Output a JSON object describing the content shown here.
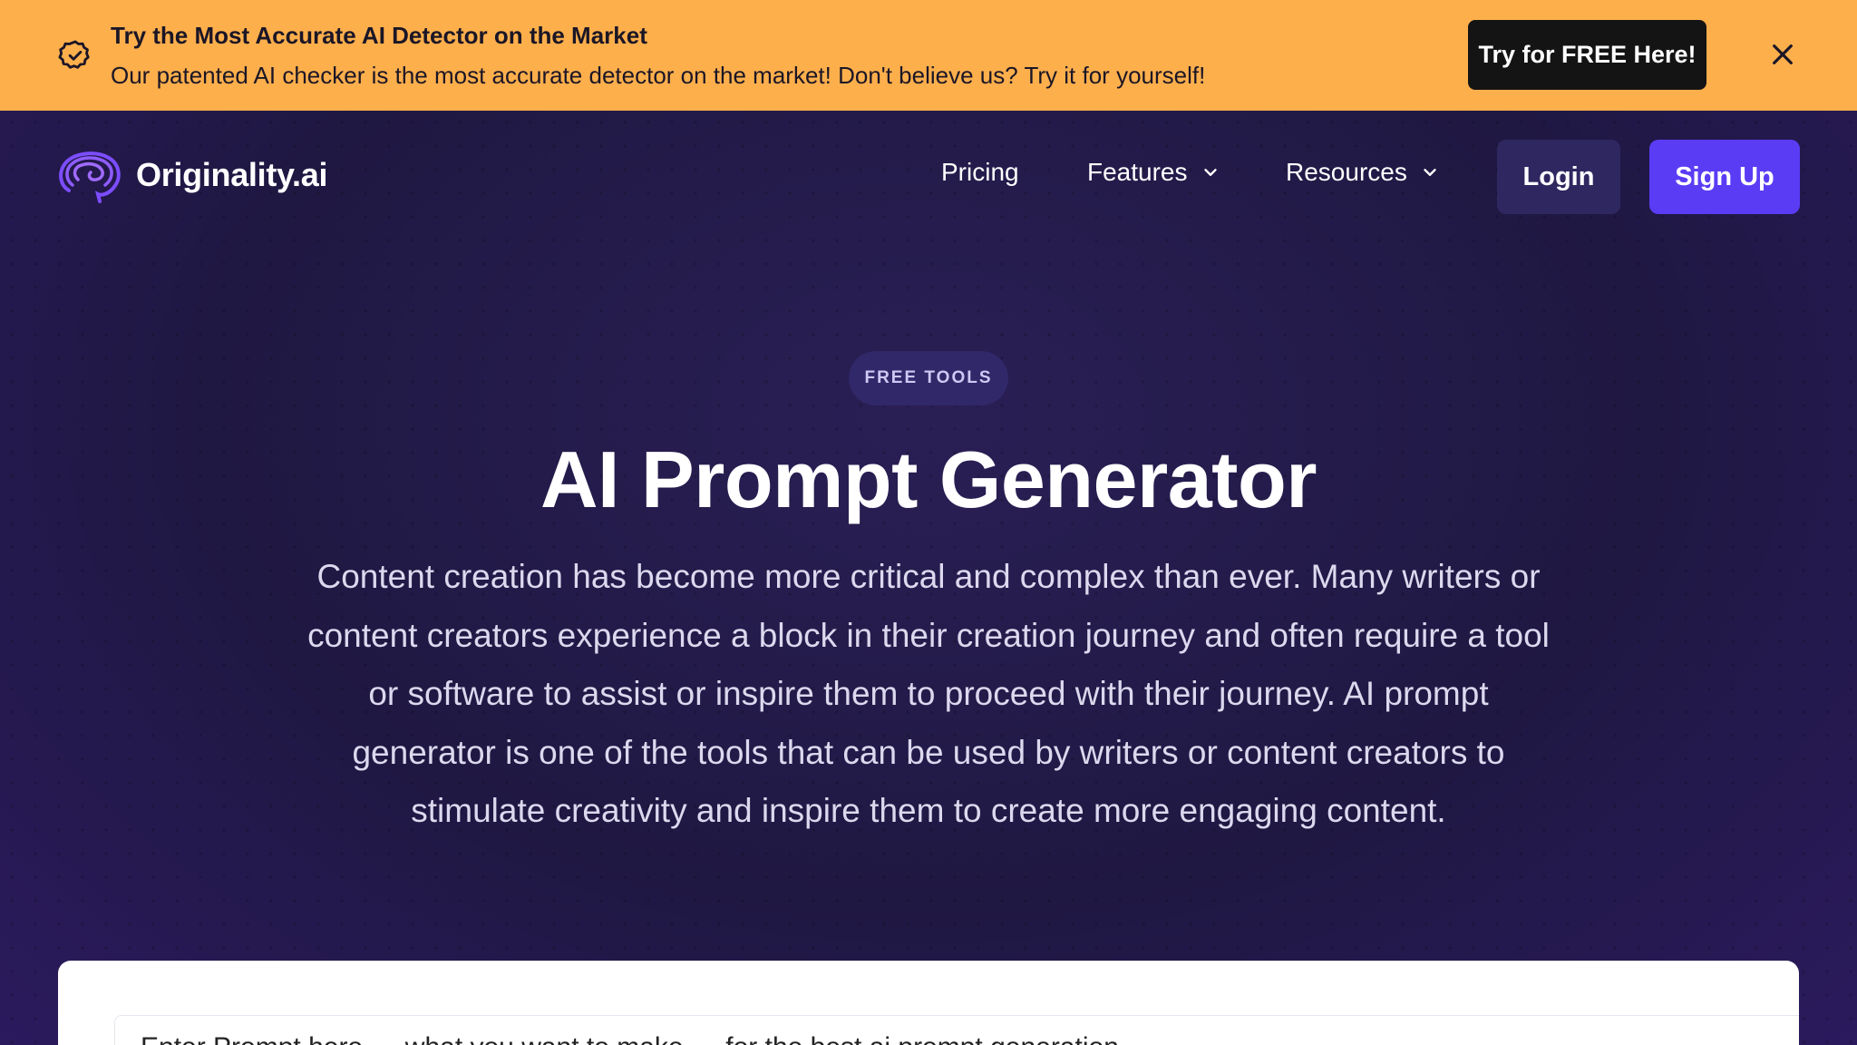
{
  "banner": {
    "title": "Try the Most Accurate AI Detector on the Market",
    "subtitle": "Our patented AI checker is the most accurate detector on the market! Don't believe us? Try it for yourself!",
    "cta_label": "Try for FREE Here!",
    "badge_icon": "verified-badge-icon",
    "close_icon": "close-icon",
    "background": "#fdaf4c"
  },
  "nav": {
    "brand": "Originality.ai",
    "logo_icon": "brain-logo-icon",
    "links": [
      {
        "label": "Pricing"
      },
      {
        "label": "Features",
        "icon": "chevron-down-icon"
      },
      {
        "label": "Resources",
        "icon": "chevron-down-icon"
      }
    ],
    "login_label": "Login",
    "signup_label": "Sign Up",
    "accent": "#5b3cf5"
  },
  "hero": {
    "pill": "FREE TOOLS",
    "title": "AI Prompt Generator",
    "description": "Content creation has become more critical and complex than ever. Many writers or content creators experience a block in their creation journey and often require a tool or software to assist or inspire them to proceed with their journey. AI prompt generator is one of the tools that can be used by writers or content creators to stimulate creativity and inspire them to create more engaging content."
  },
  "card": {
    "partial_text": "Enter Prompt here — what you want to make — for the best ai prompt generation"
  }
}
